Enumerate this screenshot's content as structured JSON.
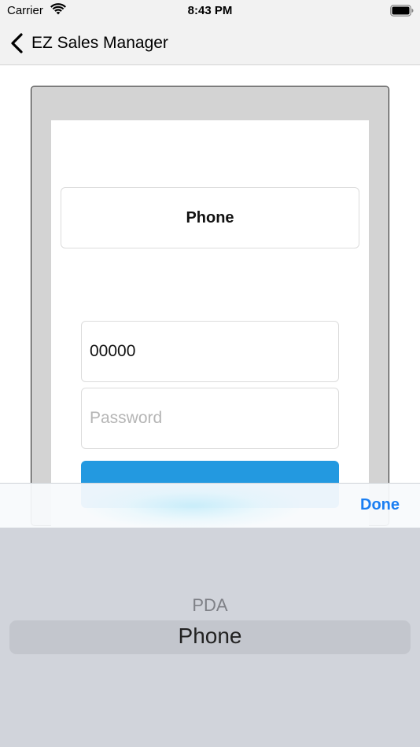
{
  "status_bar": {
    "carrier": "Carrier",
    "time": "8:43 PM",
    "icons": [
      "wifi-icon",
      "battery-icon"
    ]
  },
  "nav": {
    "back_icon": "chevron-left-icon",
    "title": "EZ Sales Manager"
  },
  "login_form": {
    "device_type_label": "Phone",
    "username_value": "00000",
    "password_placeholder": "Password"
  },
  "picker": {
    "done_label": "Done",
    "options": [
      "PDA",
      "Phone"
    ],
    "selected": "Phone"
  },
  "colors": {
    "accent": "#1a7ef2",
    "login_button": "#2399e0",
    "picker_background": "#d1d4db"
  }
}
